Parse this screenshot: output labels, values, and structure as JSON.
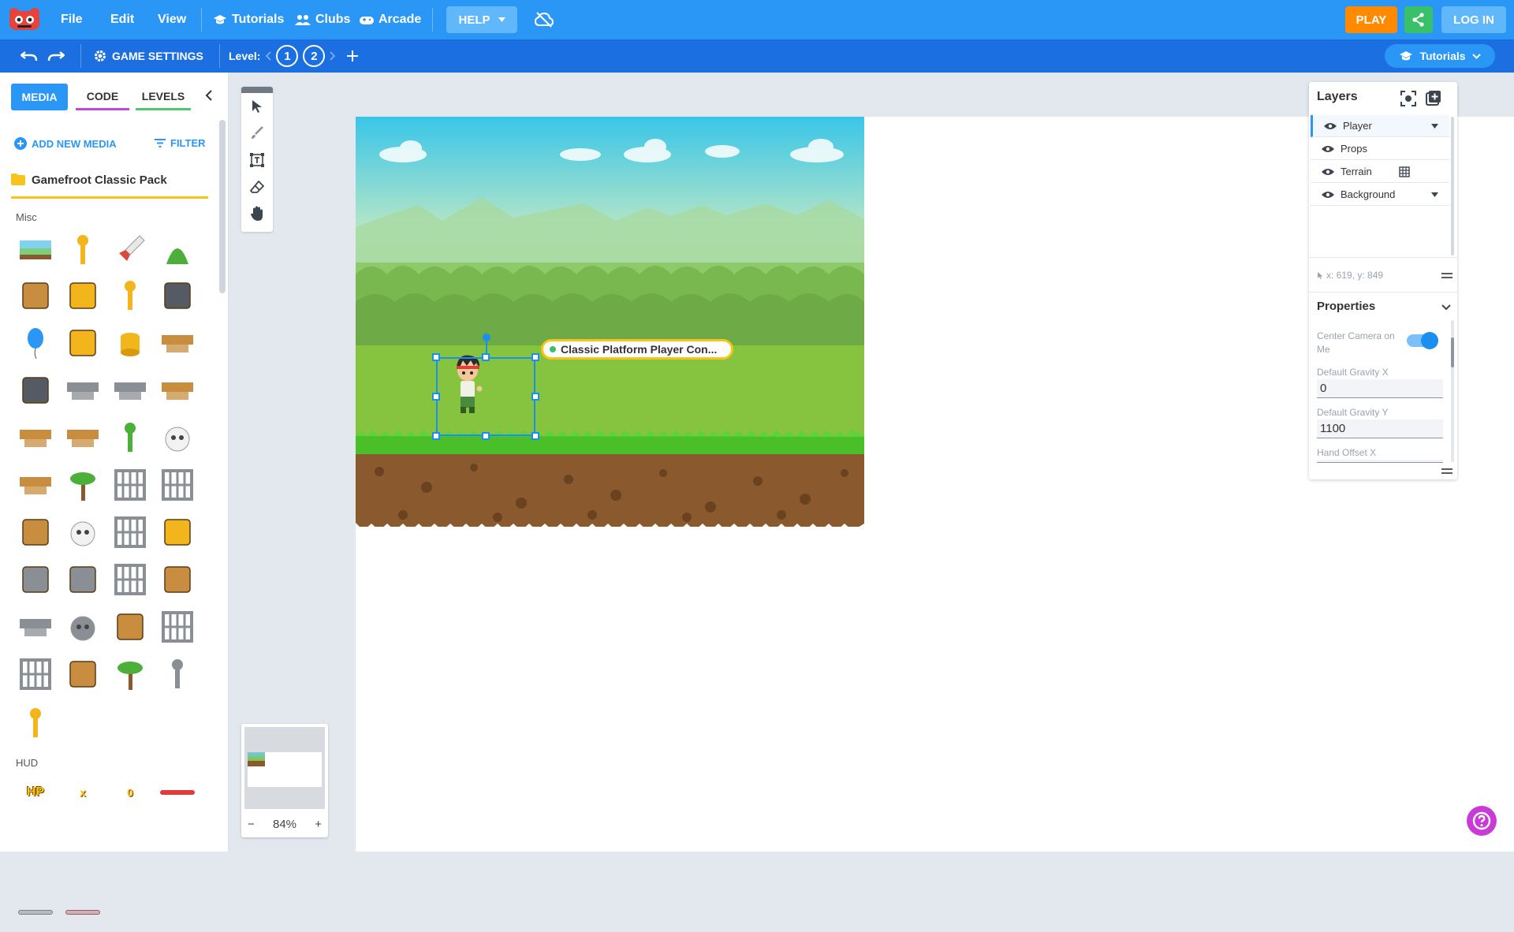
{
  "topbar": {
    "menu_file": "File",
    "menu_edit": "Edit",
    "menu_view": "View",
    "tutorials": "Tutorials",
    "clubs": "Clubs",
    "arcade": "Arcade",
    "help": "HELP",
    "play": "PLAY",
    "login": "LOG IN"
  },
  "subbar": {
    "game_settings": "GAME SETTINGS",
    "level_label": "Level:",
    "levels": [
      "1",
      "2"
    ],
    "active_level": "2",
    "tutorials_select": "Tutorials"
  },
  "leftpanel": {
    "tabs": [
      "MEDIA",
      "CODE",
      "LEVELS"
    ],
    "add_new_media": "ADD NEW MEDIA",
    "filter": "FILTER",
    "pack_title": "Gamefroot Classic Pack",
    "section_misc": "Misc",
    "section_hud": "HUD",
    "misc_items": [
      "scene-thumb",
      "trophy",
      "rocket",
      "green-slime",
      "treasure-chest",
      "spikes",
      "stopwatch",
      "feather",
      "balloon",
      "mystery-box",
      "coin-stack",
      "bed",
      "house",
      "stone-ledge",
      "stone-ledge-2",
      "wood-ledge",
      "wood-plank",
      "wood-ledge-2",
      "flower",
      "snowman",
      "wood-platform",
      "dead-tree",
      "grate",
      "grate-2",
      "barrel",
      "skull",
      "bridge",
      "hay-bale",
      "tombstone",
      "stone-block",
      "bridge-2",
      "oil-barrel",
      "stone-ledge-3",
      "boulder",
      "crate",
      "girder",
      "bridge-3",
      "green-barrel",
      "palm-tree",
      "statue",
      "torch"
    ],
    "hud_items": [
      "HP",
      "x",
      "0",
      "bar"
    ]
  },
  "scene": {
    "object_label": "Classic Platform Player Con..."
  },
  "minimap": {
    "zoom": "84%",
    "minus": "−",
    "plus": "+"
  },
  "layers_panel": {
    "title": "Layers",
    "layers": [
      {
        "name": "Player",
        "selected": true
      },
      {
        "name": "Props"
      },
      {
        "name": "Terrain"
      },
      {
        "name": "Background"
      }
    ],
    "cursor_coords": "x: 619, y: 849",
    "properties_title": "Properties",
    "center_camera_label": "Center Camera on Me",
    "center_camera_on": true,
    "gravity_x_label": "Default Gravity X",
    "gravity_x": "0",
    "gravity_y_label": "Default Gravity Y",
    "gravity_y": "1100",
    "hand_offset_label": "Hand Offset X"
  },
  "colors": {
    "topbar": "#2a96f5",
    "subbar": "#1b6fe0",
    "play": "#ff8a00",
    "share": "#3bc06a",
    "selection": "#1b8ff0",
    "highlight": "#f8c41b"
  }
}
